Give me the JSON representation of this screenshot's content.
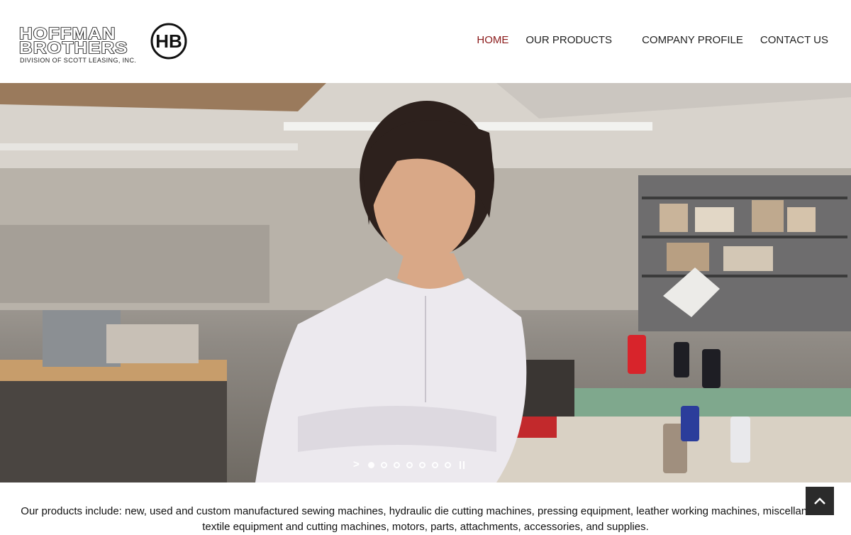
{
  "brand": {
    "name_line1": "HOFFMAN",
    "name_line2": "BROTHERS",
    "tagline": "DIVISION OF SCOTT LEASING, INC.",
    "monogram": "HB"
  },
  "nav": {
    "items": [
      {
        "label": "HOME",
        "active": true
      },
      {
        "label": "OUR PRODUCTS",
        "active": false
      },
      {
        "label": "COMPANY PROFILE",
        "active": false
      },
      {
        "label": "CONTACT US",
        "active": false
      }
    ],
    "active_color": "#8b1a1a"
  },
  "slider": {
    "next_icon": ">",
    "slide_count": 7,
    "active_slide": 1,
    "pause_icon": "pause-icon"
  },
  "intro": {
    "line1": "Our products include: new, used and custom manufactured sewing machines, hydraulic die cutting machines, pressing equipment, leather working machines, miscellaneous",
    "line2": "textile equipment and cutting machines, motors, parts, attachments, accessories, and supplies."
  },
  "back_to_top": {
    "icon": "chevron-up-icon"
  }
}
